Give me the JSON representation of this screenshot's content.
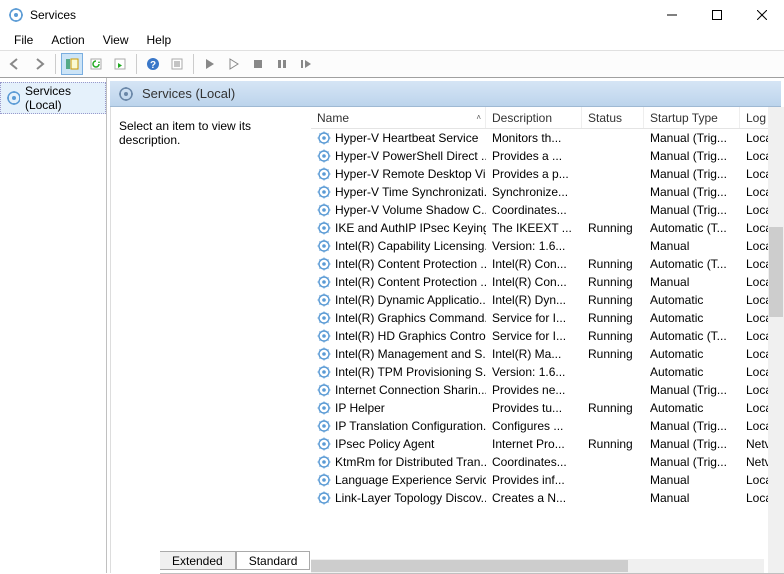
{
  "window": {
    "title": "Services"
  },
  "menus": {
    "file": "File",
    "action": "Action",
    "view": "View",
    "help": "Help"
  },
  "tree": {
    "root": "Services (Local)"
  },
  "header": {
    "label": "Services (Local)"
  },
  "descpane": {
    "text": "Select an item to view its description."
  },
  "columns": {
    "name": "Name",
    "description": "Description",
    "status": "Status",
    "startup": "Startup Type",
    "logon": "Log"
  },
  "col_widths": {
    "name": 175,
    "description": 96,
    "status": 62,
    "startup": 96,
    "logon": 40
  },
  "services": [
    {
      "name": "Hyper-V Heartbeat Service",
      "desc": "Monitors th...",
      "status": "",
      "startup": "Manual (Trig...",
      "logon": "Loca"
    },
    {
      "name": "Hyper-V PowerShell Direct ...",
      "desc": "Provides a ...",
      "status": "",
      "startup": "Manual (Trig...",
      "logon": "Loca"
    },
    {
      "name": "Hyper-V Remote Desktop Vi...",
      "desc": "Provides a p...",
      "status": "",
      "startup": "Manual (Trig...",
      "logon": "Loca"
    },
    {
      "name": "Hyper-V Time Synchronizati...",
      "desc": "Synchronize...",
      "status": "",
      "startup": "Manual (Trig...",
      "logon": "Loca"
    },
    {
      "name": "Hyper-V Volume Shadow C...",
      "desc": "Coordinates...",
      "status": "",
      "startup": "Manual (Trig...",
      "logon": "Loca"
    },
    {
      "name": "IKE and AuthIP IPsec Keying...",
      "desc": "The IKEEXT ...",
      "status": "Running",
      "startup": "Automatic (T...",
      "logon": "Loca"
    },
    {
      "name": "Intel(R) Capability Licensing...",
      "desc": "Version: 1.6...",
      "status": "",
      "startup": "Manual",
      "logon": "Loca"
    },
    {
      "name": "Intel(R) Content Protection ...",
      "desc": "Intel(R) Con...",
      "status": "Running",
      "startup": "Automatic (T...",
      "logon": "Loca"
    },
    {
      "name": "Intel(R) Content Protection ...",
      "desc": "Intel(R) Con...",
      "status": "Running",
      "startup": "Manual",
      "logon": "Loca"
    },
    {
      "name": "Intel(R) Dynamic Applicatio...",
      "desc": "Intel(R) Dyn...",
      "status": "Running",
      "startup": "Automatic",
      "logon": "Loca"
    },
    {
      "name": "Intel(R) Graphics Command...",
      "desc": "Service for I...",
      "status": "Running",
      "startup": "Automatic",
      "logon": "Loca"
    },
    {
      "name": "Intel(R) HD Graphics Contro...",
      "desc": "Service for I...",
      "status": "Running",
      "startup": "Automatic (T...",
      "logon": "Loca"
    },
    {
      "name": "Intel(R) Management and S...",
      "desc": "Intel(R) Ma...",
      "status": "Running",
      "startup": "Automatic",
      "logon": "Loca"
    },
    {
      "name": "Intel(R) TPM Provisioning S...",
      "desc": "Version: 1.6...",
      "status": "",
      "startup": "Automatic",
      "logon": "Loca"
    },
    {
      "name": "Internet Connection Sharin...",
      "desc": "Provides ne...",
      "status": "",
      "startup": "Manual (Trig...",
      "logon": "Loca"
    },
    {
      "name": "IP Helper",
      "desc": "Provides tu...",
      "status": "Running",
      "startup": "Automatic",
      "logon": "Loca"
    },
    {
      "name": "IP Translation Configuration...",
      "desc": "Configures ...",
      "status": "",
      "startup": "Manual (Trig...",
      "logon": "Loca"
    },
    {
      "name": "IPsec Policy Agent",
      "desc": "Internet Pro...",
      "status": "Running",
      "startup": "Manual (Trig...",
      "logon": "Netv"
    },
    {
      "name": "KtmRm for Distributed Tran...",
      "desc": "Coordinates...",
      "status": "",
      "startup": "Manual (Trig...",
      "logon": "Netv"
    },
    {
      "name": "Language Experience Service",
      "desc": "Provides inf...",
      "status": "",
      "startup": "Manual",
      "logon": "Loca"
    },
    {
      "name": "Link-Layer Topology Discov...",
      "desc": "Creates a N...",
      "status": "",
      "startup": "Manual",
      "logon": "Loca"
    }
  ],
  "tabs": {
    "extended": "Extended",
    "standard": "Standard"
  }
}
